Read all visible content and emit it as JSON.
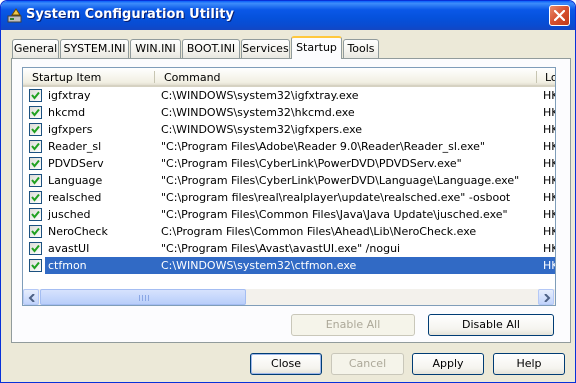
{
  "window": {
    "title": "System Configuration Utility"
  },
  "tabs": [
    {
      "label": "General",
      "active": false
    },
    {
      "label": "SYSTEM.INI",
      "active": false
    },
    {
      "label": "WIN.INI",
      "active": false
    },
    {
      "label": "BOOT.INI",
      "active": false
    },
    {
      "label": "Services",
      "active": false
    },
    {
      "label": "Startup",
      "active": true
    },
    {
      "label": "Tools",
      "active": false
    }
  ],
  "startup_list": {
    "columns": {
      "item": "Startup Item",
      "command": "Command",
      "location": "Lo"
    },
    "rows": [
      {
        "name": "igfxtray",
        "command": "C:\\WINDOWS\\system32\\igfxtray.exe",
        "location": "HK",
        "checked": true,
        "selected": false
      },
      {
        "name": "hkcmd",
        "command": "C:\\WINDOWS\\system32\\hkcmd.exe",
        "location": "HK",
        "checked": true,
        "selected": false
      },
      {
        "name": "igfxpers",
        "command": "C:\\WINDOWS\\system32\\igfxpers.exe",
        "location": "HK",
        "checked": true,
        "selected": false
      },
      {
        "name": "Reader_sl",
        "command": "\"C:\\Program Files\\Adobe\\Reader 9.0\\Reader\\Reader_sl.exe\"",
        "location": "HK",
        "checked": true,
        "selected": false
      },
      {
        "name": "PDVDServ",
        "command": "\"C:\\Program Files\\CyberLink\\PowerDVD\\PDVDServ.exe\"",
        "location": "HK",
        "checked": true,
        "selected": false
      },
      {
        "name": "Language",
        "command": "\"C:\\Program Files\\CyberLink\\PowerDVD\\Language\\Language.exe\"",
        "location": "HK",
        "checked": true,
        "selected": false
      },
      {
        "name": "realsched",
        "command": "\"C:\\program files\\real\\realplayer\\update\\realsched.exe\"  -osboot",
        "location": "HK",
        "checked": true,
        "selected": false
      },
      {
        "name": "jusched",
        "command": "\"C:\\Program Files\\Common Files\\Java\\Java Update\\jusched.exe\"",
        "location": "HK",
        "checked": true,
        "selected": false
      },
      {
        "name": "NeroCheck",
        "command": "C:\\Program Files\\Common Files\\Ahead\\Lib\\NeroCheck.exe",
        "location": "HK",
        "checked": true,
        "selected": false
      },
      {
        "name": "avastUI",
        "command": "\"C:\\Program Files\\Avast\\avastUI.exe\" /nogui",
        "location": "HK",
        "checked": true,
        "selected": false
      },
      {
        "name": "ctfmon",
        "command": "C:\\WINDOWS\\system32\\ctfmon.exe",
        "location": "HK",
        "checked": true,
        "selected": true
      }
    ]
  },
  "panel_buttons": {
    "enable_all": "Enable All",
    "disable_all": "Disable All"
  },
  "dialog_buttons": {
    "close": "Close",
    "cancel": "Cancel",
    "apply": "Apply",
    "help": "Help"
  },
  "colors": {
    "title_bar": "#0a58e8",
    "selection": "#316ac5",
    "active_tab_accent": "#ffc83c",
    "close_button": "#d6502f"
  }
}
